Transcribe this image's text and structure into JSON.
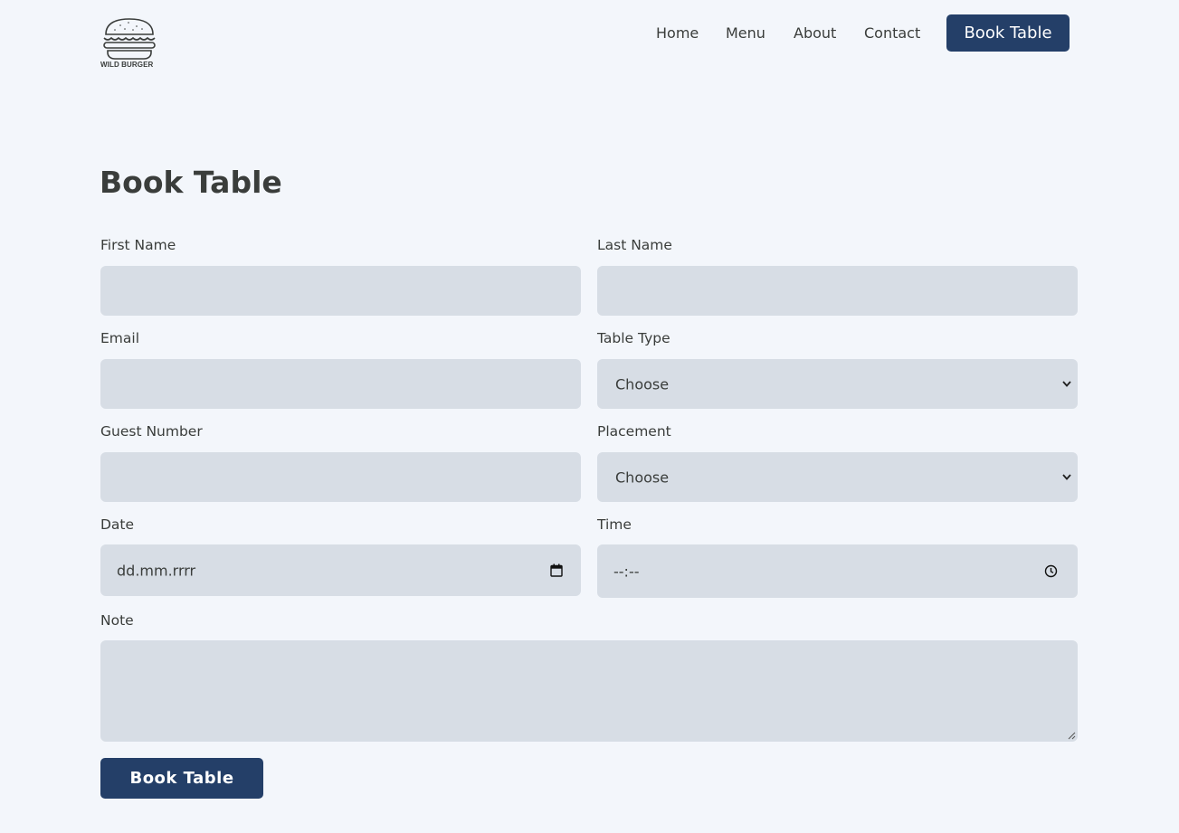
{
  "brand": {
    "name": "WILD BURGER",
    "logo_icon": "burger-icon"
  },
  "nav": {
    "links": [
      "Home",
      "Menu",
      "About",
      "Contact"
    ],
    "cta_label": "Book Table"
  },
  "page": {
    "title": "Book Table"
  },
  "form": {
    "first_name": {
      "label": "First Name",
      "value": ""
    },
    "last_name": {
      "label": "Last Name",
      "value": ""
    },
    "email": {
      "label": "Email",
      "value": ""
    },
    "table_type": {
      "label": "Table Type",
      "selected": "Choose"
    },
    "guest_number": {
      "label": "Guest Number",
      "value": ""
    },
    "placement": {
      "label": "Placement",
      "selected": "Choose"
    },
    "date": {
      "label": "Date",
      "placeholder": "dd.mm.rrrr"
    },
    "time": {
      "label": "Time",
      "placeholder": "--:--"
    },
    "note": {
      "label": "Note",
      "value": ""
    },
    "submit_label": "Book Table"
  },
  "colors": {
    "background": "#f3f6fb",
    "field": "#d7dde5",
    "accent": "#243f68",
    "text": "#3a3d3b"
  }
}
